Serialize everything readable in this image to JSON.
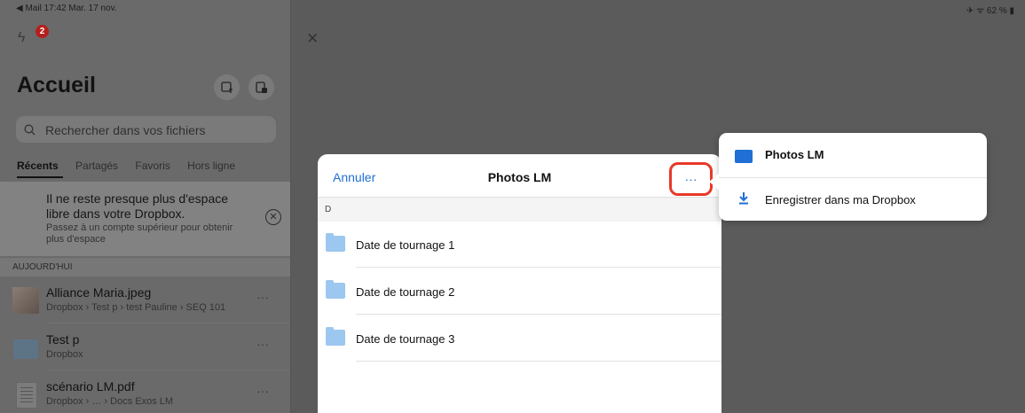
{
  "status": {
    "back_app": "◀ Mail",
    "time": "17:42",
    "date": "Mar. 17 nov.",
    "battery": "✈ ᯤ 62 % ▮"
  },
  "sidebar": {
    "notification_count": "2",
    "title": "Accueil",
    "search_placeholder": "Rechercher dans vos fichiers",
    "tabs": [
      "Récents",
      "Partagés",
      "Favoris",
      "Hors ligne"
    ],
    "banner": {
      "title": "Il ne reste presque plus d'espace libre dans votre Dropbox.",
      "subtitle": "Passez à un compte supérieur pour obtenir plus d'espace"
    },
    "section_label": "AUJOURD'HUI",
    "files": [
      {
        "name": "Alliance Maria.jpeg",
        "path": "Dropbox › Test p › test Pauline › SEQ 101"
      },
      {
        "name": "Test p",
        "path": "Dropbox"
      },
      {
        "name": "scénario LM.pdf",
        "path": "Dropbox › … › Docs Exos LM"
      }
    ],
    "more_label": "···"
  },
  "modal": {
    "cancel_label": "Annuler",
    "title": "Photos LM",
    "more_label": "···",
    "section_letter": "D",
    "folders": [
      "Date de tournage 1",
      "Date de tournage 2",
      "Date de tournage 3"
    ]
  },
  "popover": {
    "folder_label": "Photos LM",
    "save_label": "Enregistrer dans ma Dropbox"
  },
  "colors": {
    "accent": "#1f6fd6",
    "highlight": "#e8392a",
    "badge": "#b51f1c",
    "folder": "#9cc7ef"
  }
}
